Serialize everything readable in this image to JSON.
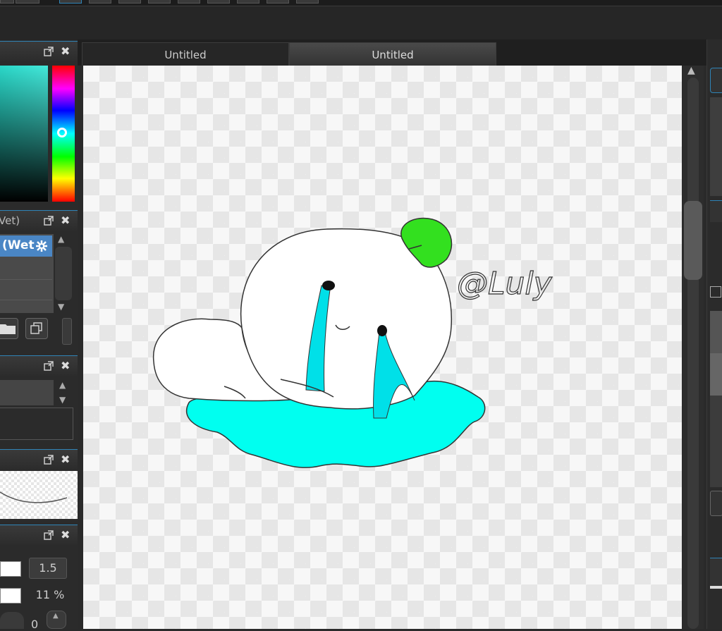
{
  "tabs": [
    {
      "label": "Untitled",
      "active": false
    },
    {
      "label": "Untitled",
      "active": true
    }
  ],
  "left_panel": {
    "brush_panel_title": "Vet)",
    "brush_selected_label": "(Wet",
    "num1": "1.5",
    "num2": "11 %",
    "num3": "0"
  },
  "canvas_text": "@Luly",
  "colors": {
    "accent": "#2f84b7",
    "selection": "#4a86c5",
    "puddle": "#00fff0",
    "leaf": "#33e01f"
  }
}
